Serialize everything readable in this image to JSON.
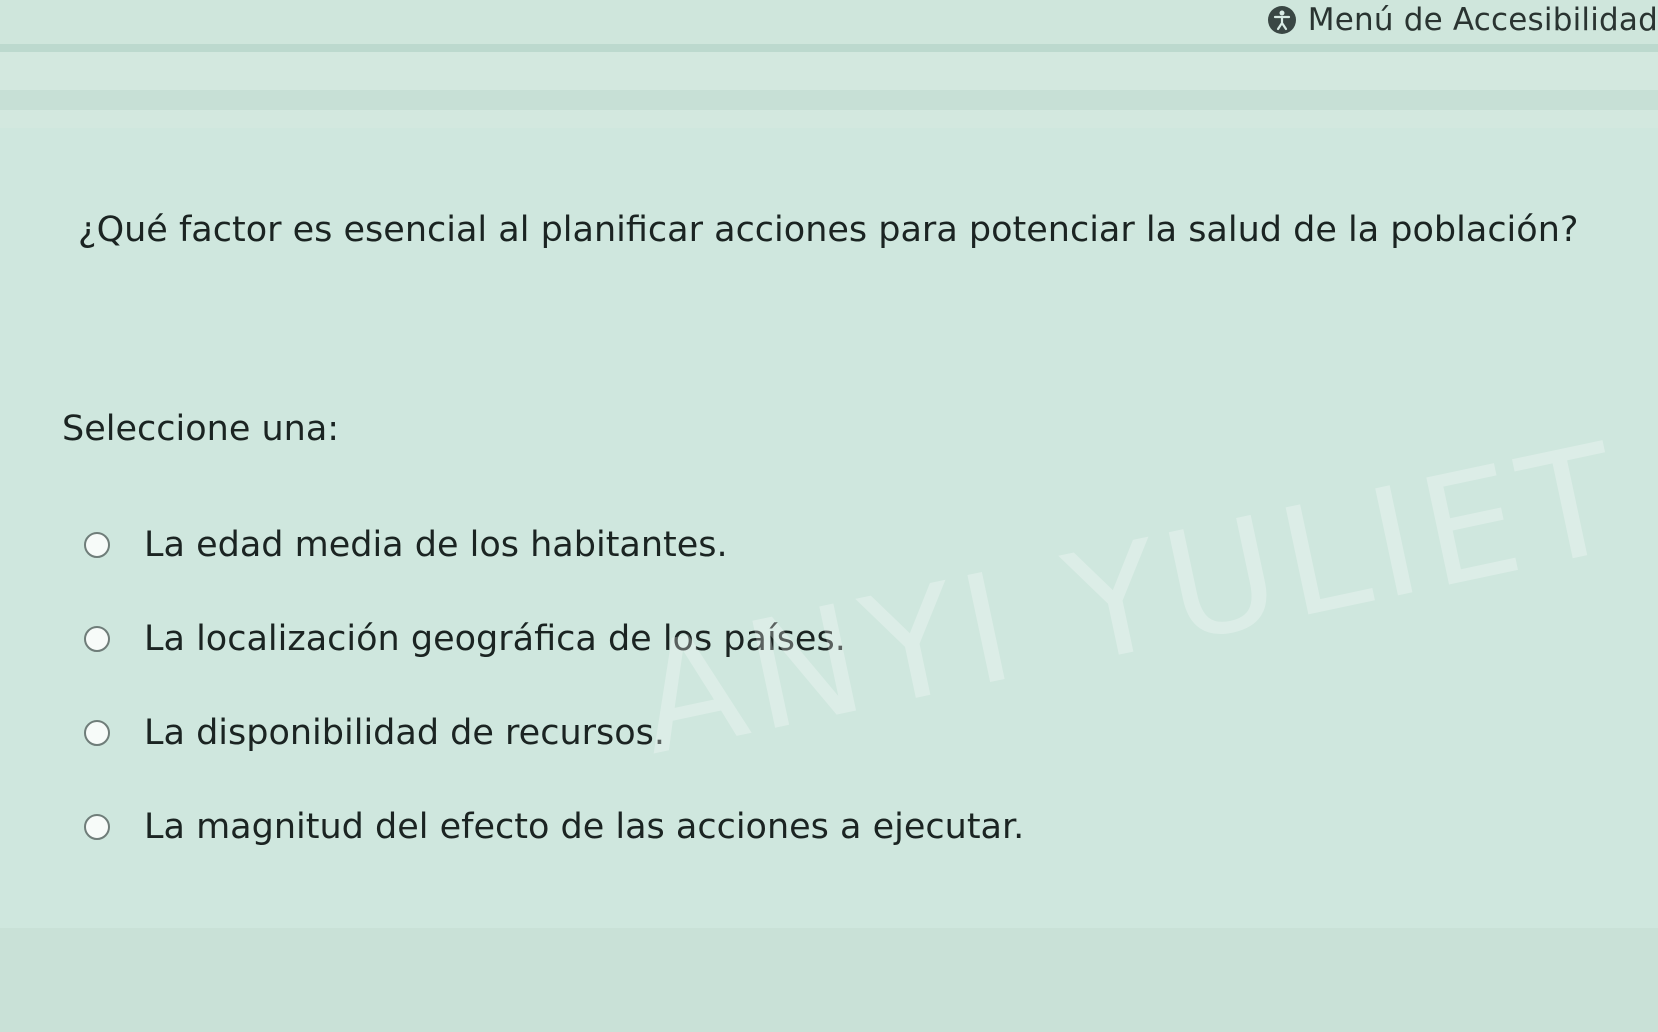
{
  "header": {
    "accessibility_menu_label": "Menú de Accesibilidad",
    "accessibility_icon": "accessibility-icon"
  },
  "question": {
    "text": "¿Qué factor es esencial al planificar acciones para potenciar la salud de la población?",
    "prompt": "Seleccione una:",
    "options": [
      {
        "label": "La edad media de los habitantes.",
        "selected": false
      },
      {
        "label": "La localización geográfica de los países.",
        "selected": false
      },
      {
        "label": "La disponibilidad de recursos.",
        "selected": false
      },
      {
        "label": "La magnitud del efecto de las acciones a ejecutar.",
        "selected": false
      }
    ]
  },
  "watermark": {
    "text": "ANYI YULIET"
  },
  "colors": {
    "background": "#d3e8df",
    "text": "#1b2422",
    "radio_border": "#6f7d79"
  }
}
